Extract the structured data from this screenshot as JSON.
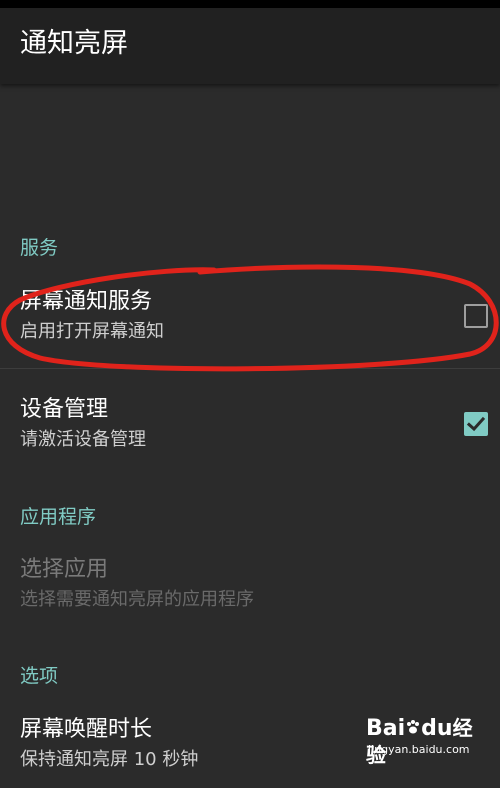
{
  "app": {
    "title": "通知亮屏"
  },
  "sections": {
    "service": {
      "header": "服务",
      "screen_notify": {
        "title": "屏幕通知服务",
        "summary": "启用打开屏幕通知",
        "checked": false
      },
      "device_admin": {
        "title": "设备管理",
        "summary": "请激活设备管理",
        "checked": true
      }
    },
    "apps": {
      "header": "应用程序",
      "select_app": {
        "title": "选择应用",
        "summary": "选择需要通知亮屏的应用程序",
        "enabled": false
      }
    },
    "options": {
      "header": "选项",
      "wake_duration": {
        "title": "屏幕唤醒时长",
        "summary": "保持通知亮屏 10 秒钟"
      }
    }
  },
  "colors": {
    "accent": "#80cbc4",
    "background": "#2b2b2b",
    "appbar": "#212121",
    "annotation": "#e0231b"
  },
  "watermark": {
    "logo_latin": "Bai",
    "logo_latin_tail": "du",
    "logo_cn": "经验",
    "url": "jingyan.baidu.com"
  }
}
